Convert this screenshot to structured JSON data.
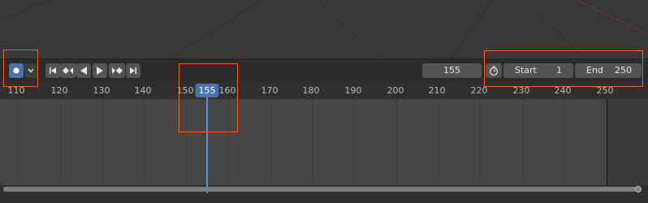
{
  "toolbar": {
    "record_icon": "record-dot-icon",
    "dropdown_icon": "chevron-down-icon",
    "playback_icons": [
      "jump-to-start-icon",
      "jump-to-prev-keyframe-icon",
      "play-reverse-icon",
      "play-icon",
      "jump-to-next-keyframe-icon",
      "jump-to-end-icon"
    ],
    "current_frame": "155",
    "timer_icon": "stopwatch-icon",
    "start_label": "Start",
    "start_value": "1",
    "end_label": "End",
    "end_value": "250"
  },
  "ruler": {
    "ticks": [
      "110",
      "120",
      "130",
      "140",
      "150",
      "160",
      "170",
      "180",
      "190",
      "200",
      "210",
      "220",
      "230",
      "240",
      "250"
    ],
    "current_frame_indicator": "155"
  },
  "colors": {
    "accent": "#4772b3",
    "highlight_box": "#ff5a1f",
    "playhead": "#5e8bd1"
  }
}
